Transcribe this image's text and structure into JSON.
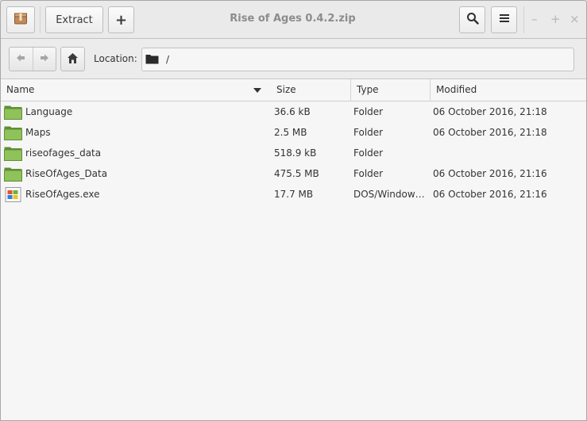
{
  "window": {
    "title": "Rise of Ages 0.4.2.zip"
  },
  "toolbar": {
    "extract_label": "Extract",
    "add_label": "+",
    "minimize_glyph": "–",
    "maximize_glyph": "+",
    "close_glyph": "×"
  },
  "location": {
    "label": "Location:",
    "path": "/"
  },
  "columns": {
    "name": "Name",
    "size": "Size",
    "type": "Type",
    "modified": "Modified"
  },
  "files": [
    {
      "name": "Language",
      "size": "36.6 kB",
      "type": "Folder",
      "modified": "06 October 2016, 21:18",
      "icon": "folder-icon"
    },
    {
      "name": "Maps",
      "size": "2.5 MB",
      "type": "Folder",
      "modified": "06 October 2016, 21:18",
      "icon": "folder-icon"
    },
    {
      "name": "riseofages_data",
      "size": "518.9 kB",
      "type": "Folder",
      "modified": "",
      "icon": "folder-icon"
    },
    {
      "name": "RiseOfAges_Data",
      "size": "475.5 MB",
      "type": "Folder",
      "modified": "06 October 2016, 21:16",
      "icon": "folder-icon"
    },
    {
      "name": "RiseOfAges.exe",
      "size": "17.7 MB",
      "type": "DOS/Windows …",
      "modified": "06 October 2016, 21:16",
      "icon": "windows-executable-icon"
    }
  ],
  "colors": {
    "folder_green": "#7ab04a",
    "header_bg": "#eaeaea"
  }
}
